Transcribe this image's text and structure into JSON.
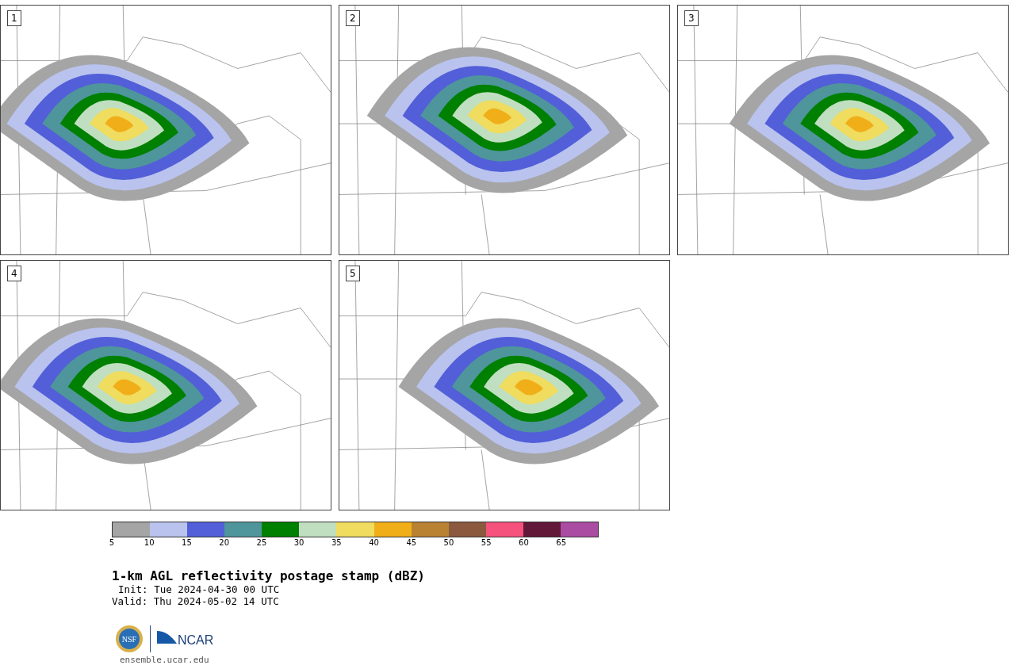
{
  "panels": [
    {
      "number": "1"
    },
    {
      "number": "2"
    },
    {
      "number": "3"
    },
    {
      "number": "4"
    },
    {
      "number": "5"
    }
  ],
  "colorbar": {
    "segments": [
      {
        "color": "#a5a5a5"
      },
      {
        "color": "#b9c3ee"
      },
      {
        "color": "#525fd8"
      },
      {
        "color": "#4f959c"
      },
      {
        "color": "#008000"
      },
      {
        "color": "#c0dfc0"
      },
      {
        "color": "#f0dc5e"
      },
      {
        "color": "#f0ae18"
      },
      {
        "color": "#b88232"
      },
      {
        "color": "#8b5a3e"
      },
      {
        "color": "#f4527d"
      },
      {
        "color": "#621838"
      },
      {
        "color": "#aa4ca2"
      }
    ],
    "ticks": [
      "5",
      "10",
      "15",
      "20",
      "25",
      "30",
      "35",
      "40",
      "45",
      "50",
      "55",
      "60",
      "65"
    ]
  },
  "title": "1-km AGL reflectivity postage stamp (dBZ)",
  "init": "Init: Tue 2024-04-30 00 UTC",
  "valid": "Valid: Thu 2024-05-02 14 UTC",
  "logos": [
    {
      "text": "NSF"
    },
    {
      "text": "NCAR"
    }
  ],
  "url": "ensemble.ucar.edu"
}
